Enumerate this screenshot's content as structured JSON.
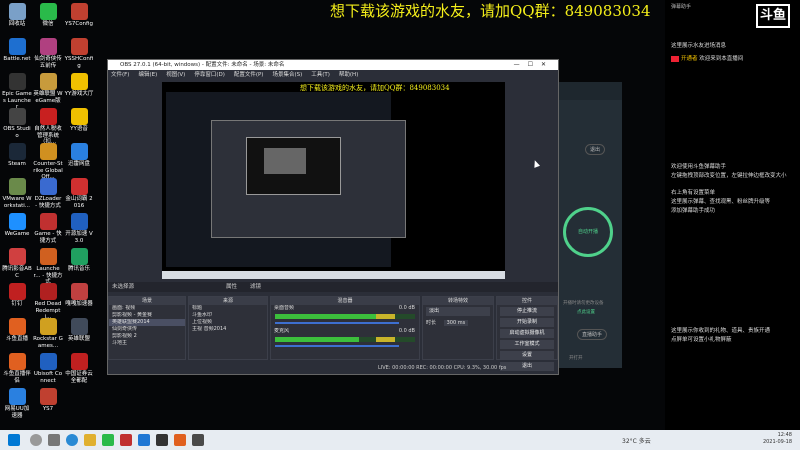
{
  "banner": {
    "text": "想下载该游戏的水友，请加QQ群：849083034"
  },
  "desktop_icons": [
    {
      "label": "回收站",
      "color": "#7aa0c8"
    },
    {
      "label": "微信",
      "color": "#2aba4a"
    },
    {
      "label": "YS7Config",
      "color": "#c04030"
    },
    {
      "label": "Battle.net",
      "color": "#1e6fd0"
    },
    {
      "label": "仙剑奇侠传五前传",
      "color": "#b04080"
    },
    {
      "label": "YSSHConfig",
      "color": "#c04030"
    },
    {
      "label": "Epic Games Launcher",
      "color": "#333333"
    },
    {
      "label": "英雄联盟 WeGame版",
      "color": "#c89b3c"
    },
    {
      "label": "YY游戏大厅",
      "color": "#f0c000"
    },
    {
      "label": "OBS Studio",
      "color": "#444444"
    },
    {
      "label": "自然人税收管理系统（扣...",
      "color": "#c82020"
    },
    {
      "label": "YY语音",
      "color": "#f0c000"
    },
    {
      "label": "Steam",
      "color": "#1b2838"
    },
    {
      "label": "Counter-Strike Global Off...",
      "color": "#d09020"
    },
    {
      "label": "迅雷网盘",
      "color": "#2a80e0"
    },
    {
      "label": "VMware Workstati...",
      "color": "#6a8a4a"
    },
    {
      "label": "DZLoader - 快捷方式",
      "color": "#3a6ad0"
    },
    {
      "label": "金山词霸 2016",
      "color": "#d03030"
    },
    {
      "label": "WeGame",
      "color": "#1e90ff"
    },
    {
      "label": "Game - 快捷方式",
      "color": "#c03030"
    },
    {
      "label": "开源加速 V3.0",
      "color": "#2060c0"
    },
    {
      "label": "腾讯影音ABC",
      "color": "#d04040"
    },
    {
      "label": "Launcher... - 快捷方式",
      "color": "#d06020"
    },
    {
      "label": "腾讯音乐",
      "color": "#20a060"
    },
    {
      "label": "钉钉",
      "color": "#c02020"
    },
    {
      "label": "Red Dead Redempti...",
      "color": "#b02020"
    },
    {
      "label": "嘎嘎加速器",
      "color": "#c04040"
    },
    {
      "label": "斗鱼直播",
      "color": "#e06020"
    },
    {
      "label": "Rockstar Games...",
      "color": "#d0a020"
    },
    {
      "label": "英雄联盟",
      "color": "#404a5a"
    },
    {
      "label": "斗鱼直播伴侣",
      "color": "#e06020"
    },
    {
      "label": "Ubisoft Connect",
      "color": "#2060c0"
    },
    {
      "label": "中国证券云全都配",
      "color": "#c02020"
    },
    {
      "label": "网易UU加速器",
      "color": "#2a80e0"
    },
    {
      "label": "YS7",
      "color": "#c04030"
    }
  ],
  "danmu": {
    "header": "弹幕助手",
    "logo": "斗鱼",
    "m1": "这里展示水友进场消息",
    "m2_tag": "开通者",
    "m2": "欢迎来到本直播间",
    "m3": "欢迎使用斗鱼弹幕助手",
    "m4": "左键拖拽顶部改变位置，左键拉伸边框改变大小",
    "m5": "右上角有设置菜单",
    "m6": "这里展示弹幕、查找观黑、粉丝牌升级等",
    "m7": "添加弹幕助手成功",
    "m8": "这里展示你收到的礼物、道具、贵族开通",
    "m9": "点屏单可设置小礼物屏蔽"
  },
  "assist": {
    "exit": "退出",
    "center": "自动开播",
    "hint": "开播时请勿更改设备",
    "link": "点此设置",
    "btn": "直播助手",
    "foot": "开打开"
  },
  "obs": {
    "title": "OBS 27.0.1 (64-bit, windows) - 配置文件: 未命名 - 场景: 未命名",
    "menu": [
      "文件(F)",
      "编辑(E)",
      "视图(V)",
      "停靠窗口(D)",
      "配置文件(P)",
      "场景集合(S)",
      "工具(T)",
      "帮助(H)"
    ],
    "preview_banner": "想下载该游戏的水友，请加QQ群：849083034",
    "mode_label": "未选择源",
    "mode_tabs": [
      "属性",
      "滤镜"
    ],
    "scenes_title": "场景",
    "scenes": [
      "画面: 视频",
      "剪影视频 - 黄金赛",
      "英雄联盟赛2014",
      "仙剑奇侠传",
      "剪影视频 2",
      "斗地主"
    ],
    "sources_title": "来源",
    "sources": [
      "标题",
      "斗鱼水印",
      "上位视频",
      "主视 音频2014"
    ],
    "mixer_title": "混音器",
    "mixer": [
      {
        "name": "桌面音频",
        "db": "0.0 dB",
        "level": 0.72
      },
      {
        "name": "麦克风",
        "db": "0.0 dB",
        "level": 0.6
      }
    ],
    "trans_title": "转场特效",
    "trans_type": "淡出",
    "trans_dur_label": "时长",
    "trans_dur": "300 ms",
    "controls_title": "控件",
    "controls": [
      "停止推流",
      "开始录制",
      "启动虚拟摄像机",
      "工作室模式",
      "设置",
      "退出"
    ],
    "status": "LIVE: 00:00:00    REC: 00:00:00    CPU: 9.3%, 30.00 fps"
  },
  "taskbar": {
    "weather": "32°C 多云",
    "time": "12:48",
    "date": "2021-09-18"
  }
}
